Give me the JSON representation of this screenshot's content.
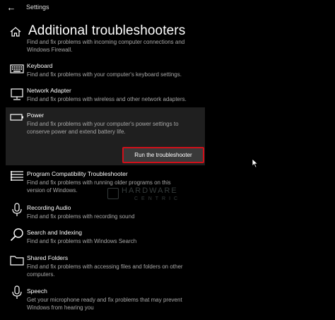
{
  "window": {
    "title": "Settings"
  },
  "header": {
    "title": "Additional troubleshooters"
  },
  "clipped_description": "Find and fix problems with incoming computer connections and\nWindows Firewall.",
  "items": [
    {
      "name": "Keyboard",
      "description": "Find and fix problems with your computer's keyboard settings.",
      "icon": "keyboard-icon"
    },
    {
      "name": "Network Adapter",
      "description": "Find and fix problems with wireless and other network adapters.",
      "icon": "network-adapter-icon"
    },
    {
      "name": "Power",
      "description": "Find and fix problems with your computer's power settings to conserve power and extend battery life.",
      "icon": "battery-icon"
    },
    {
      "name": "Program Compatibility Troubleshooter",
      "description": "Find and fix problems with running older programs on this version of Windows.",
      "icon": "program-compatibility-icon"
    },
    {
      "name": "Recording Audio",
      "description": "Find and fix problems with recording sound",
      "icon": "microphone-icon"
    },
    {
      "name": "Search and Indexing",
      "description": "Find and fix problems with Windows Search",
      "icon": "search-icon"
    },
    {
      "name": "Shared Folders",
      "description": "Find and fix problems with accessing files and folders on other computers.",
      "icon": "shared-folders-icon"
    },
    {
      "name": "Speech",
      "description": "Get your microphone ready and fix problems that may prevent Windows from hearing you",
      "icon": "speech-microphone-icon"
    }
  ],
  "power_panel": {
    "button_label": "Run the troubleshooter",
    "highlight_color": "#d0101a"
  },
  "watermark": {
    "brand": "HARDWARE",
    "sub": "CENTRIC"
  },
  "colors": {
    "background": "#000000",
    "panel": "#1f1f1f",
    "text": "#ffffff",
    "secondary_text": "#a8a8a8"
  }
}
